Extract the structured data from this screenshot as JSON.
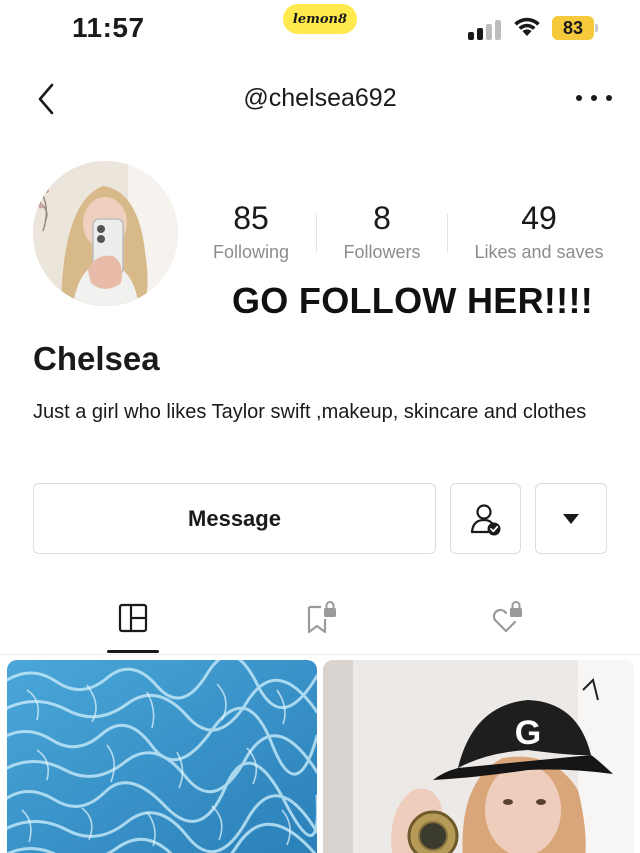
{
  "status_bar": {
    "time": "11:57",
    "app_badge": "lemon8",
    "battery_level": "83",
    "signal_bars_active": 2,
    "signal_bars_total": 4,
    "wifi": "wifi-full-icon"
  },
  "nav": {
    "title": "@chelsea692",
    "back_icon": "chevron-left-icon",
    "more_icon": "more-horizontal-icon"
  },
  "profile": {
    "name": "Chelsea",
    "bio": "Just a girl who likes Taylor swift ,makeup, skincare and clothes",
    "overlay_text": "GO FOLLOW HER!!!!",
    "stats": [
      {
        "value": "85",
        "label": "Following"
      },
      {
        "value": "8",
        "label": "Followers"
      },
      {
        "value": "49",
        "label": "Likes and saves"
      }
    ]
  },
  "actions": {
    "message_label": "Message",
    "follow_icon": "user-check-icon",
    "more_icon": "triangle-down-icon"
  },
  "tabs": [
    {
      "icon": "grid-icon",
      "active": true
    },
    {
      "icon": "bookmark-lock-icon",
      "active": false
    },
    {
      "icon": "heart-lock-icon",
      "active": false
    }
  ],
  "posts": [
    {
      "kind": "pool-water-photo"
    },
    {
      "kind": "person-with-cap-photo"
    }
  ],
  "colors": {
    "lemon_badge": "#ffe94d",
    "battery": "#f5c93b",
    "text_primary": "#1a1a1a",
    "text_secondary": "#8c8c8c",
    "border": "#dcdcdc"
  }
}
